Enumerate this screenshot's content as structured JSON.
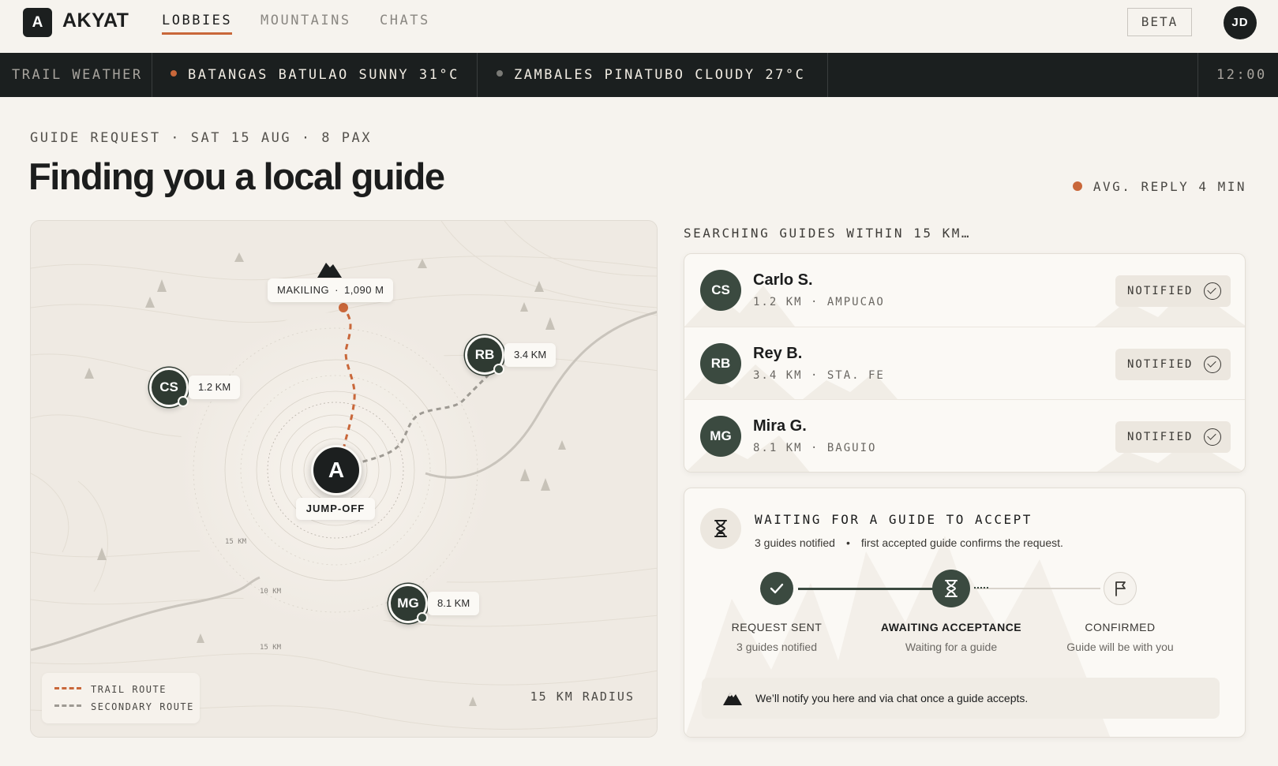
{
  "nav": {
    "logo_letter": "A",
    "brand": "AKYAT",
    "tabs": [
      {
        "label": "LOBBIES",
        "active": true
      },
      {
        "label": "MOUNTAINS",
        "active": false
      },
      {
        "label": "CHATS",
        "active": false
      }
    ],
    "beta_label": "BETA",
    "user_initials": "JD"
  },
  "ticker": {
    "label": "TRAIL WEATHER",
    "items": [
      {
        "text": "BATANGAS BATULAO SUNNY 31°C",
        "dot_color": "#c9673a"
      },
      {
        "text": "ZAMBALES PINATUBO CLOUDY 27°C",
        "dot_color": "#7a7a76"
      }
    ],
    "time": "12:00"
  },
  "header": {
    "eyebrow": "GUIDE REQUEST · SAT 15 AUG · 8 PAX",
    "title": "Finding you a local guide",
    "avg_reply": "AVG. REPLY 4 MIN"
  },
  "map": {
    "peak_label": "MAKILING",
    "peak_elevation": "1,090 M",
    "jump_off_letter": "A",
    "jump_off_label": "JUMP-OFF",
    "ring_labels": [
      "15 KM",
      "10 KM",
      "15 KM"
    ],
    "markers": [
      {
        "initials": "CS",
        "distance": "1.2 KM"
      },
      {
        "initials": "RB",
        "distance": "3.4 KM"
      },
      {
        "initials": "MG",
        "distance": "8.1 KM"
      }
    ],
    "legend": {
      "trail": "TRAIL ROUTE",
      "secondary": "SECONDARY ROUTE"
    },
    "radius_label": "15 KM RADIUS"
  },
  "search": {
    "title": "SEARCHING GUIDES WITHIN 15 KM…",
    "guides": [
      {
        "initials": "CS",
        "name": "Carlo S.",
        "meta": "1.2 KM · AMPUCAO",
        "status": "NOTIFIED"
      },
      {
        "initials": "RB",
        "name": "Rey B.",
        "meta": "3.4 KM · STA. FE",
        "status": "NOTIFIED"
      },
      {
        "initials": "MG",
        "name": "Mira G.",
        "meta": "8.1 KM · BAGUIO",
        "status": "NOTIFIED"
      }
    ]
  },
  "waiting": {
    "title": "WAITING FOR A GUIDE TO ACCEPT",
    "sub_left": "3 guides notified",
    "sub_sep": "•",
    "sub_right": "first accepted guide confirms the request.",
    "steps": [
      {
        "label": "REQUEST SENT",
        "sub": "3 guides notified",
        "state": "done"
      },
      {
        "label": "AWAITING ACCEPTANCE",
        "sub": "Waiting for a guide",
        "state": "active"
      },
      {
        "label": "CONFIRMED",
        "sub": "Guide will be with you",
        "state": "pending"
      }
    ],
    "notice": "We’ll notify you here and via chat once a guide accepts."
  },
  "colors": {
    "accent": "#c9673a",
    "dark": "#1c1f1f",
    "guide_green": "#3b4a40",
    "background": "#f6f3ee"
  }
}
